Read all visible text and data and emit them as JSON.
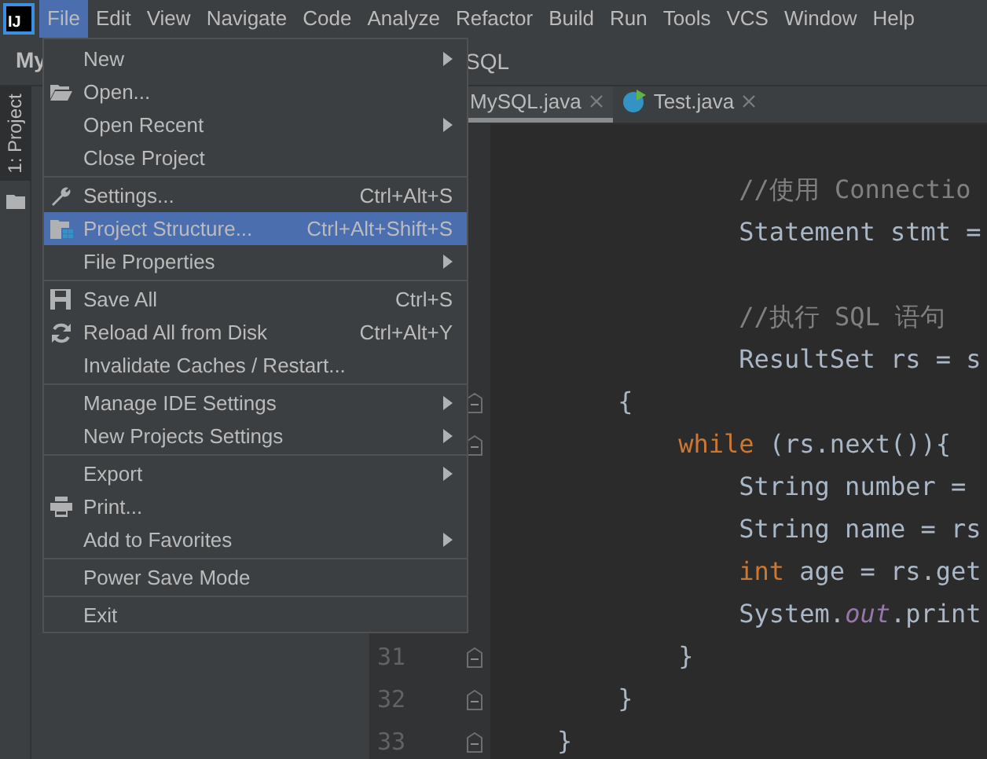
{
  "logo": {
    "text": "IJ"
  },
  "menubar": [
    {
      "label": "File",
      "selected": true
    },
    {
      "label": "Edit",
      "selected": false
    },
    {
      "label": "View",
      "selected": false
    },
    {
      "label": "Navigate",
      "selected": false
    },
    {
      "label": "Code",
      "selected": false
    },
    {
      "label": "Analyze",
      "selected": false
    },
    {
      "label": "Refactor",
      "selected": false
    },
    {
      "label": "Build",
      "selected": false
    },
    {
      "label": "Run",
      "selected": false
    },
    {
      "label": "Tools",
      "selected": false
    },
    {
      "label": "VCS",
      "selected": false
    },
    {
      "label": "Window",
      "selected": false
    },
    {
      "label": "Help",
      "selected": false
    }
  ],
  "navbar": {
    "project": "My",
    "file": "SQL"
  },
  "tool_window_tab": {
    "label": "1: Project",
    "selected": true
  },
  "editor_tabs": [
    {
      "label": "MySQL.java",
      "selected": true,
      "kind": "plain"
    },
    {
      "label": "Test.java",
      "selected": false,
      "kind": "class"
    }
  ],
  "code_blocks": [
    [
      {
        "tokens": [
          {
            "kind": "comment",
            "text": "                //使用 Connectio"
          }
        ]
      },
      {
        "tokens": [
          {
            "kind": "plain",
            "text": "                Statement stmt ="
          }
        ]
      }
    ],
    [
      {
        "tokens": [
          {
            "kind": "comment",
            "text": "                //执行 SQL 语句"
          }
        ]
      },
      {
        "tokens": [
          {
            "kind": "plain",
            "text": "                ResultSet rs = s"
          }
        ]
      },
      {
        "tokens": [
          {
            "kind": "plain",
            "text": "        {"
          }
        ],
        "fold": true
      },
      {
        "tokens": [
          {
            "kind": "keyword",
            "text": "            while"
          },
          {
            "kind": "plain",
            "text": " (rs.next()){"
          }
        ],
        "fold": true
      },
      {
        "tokens": [
          {
            "kind": "plain",
            "text": "                String number ="
          }
        ]
      },
      {
        "tokens": [
          {
            "kind": "plain",
            "text": "                String name = rs"
          }
        ]
      },
      {
        "tokens": [
          {
            "kind": "keyword",
            "text": "                int"
          },
          {
            "kind": "plain",
            "text": " age = rs.get"
          }
        ]
      },
      {
        "tokens": [
          {
            "kind": "plain",
            "text": "                System."
          },
          {
            "kind": "field",
            "text": "out"
          },
          {
            "kind": "plain",
            "text": ".print"
          }
        ]
      },
      {
        "number": "31",
        "tokens": [
          {
            "kind": "plain",
            "text": "            }"
          }
        ],
        "fold": true
      },
      {
        "number": "32",
        "tokens": [
          {
            "kind": "plain",
            "text": "        }"
          }
        ],
        "fold": true
      },
      {
        "number": "33",
        "tokens": [
          {
            "kind": "plain",
            "text": "    }"
          }
        ],
        "fold": true
      }
    ]
  ],
  "file_menu": {
    "groups": [
      [
        {
          "label": "New",
          "submenu": true,
          "selected": false
        },
        {
          "label": "Open...",
          "selected": false
        },
        {
          "label": "Open Recent",
          "submenu": true,
          "selected": false
        },
        {
          "label": "Close Project",
          "selected": false
        }
      ],
      [
        {
          "label": "Settings...",
          "shortcut": "Ctrl+Alt+S",
          "selected": false
        },
        {
          "label": "Project Structure...",
          "shortcut": "Ctrl+Alt+Shift+S",
          "selected": true
        },
        {
          "label": "File Properties",
          "submenu": true,
          "selected": false
        }
      ],
      [
        {
          "label": "Save All",
          "shortcut": "Ctrl+S",
          "selected": false
        },
        {
          "label": "Reload All from Disk",
          "shortcut": "Ctrl+Alt+Y",
          "selected": false
        },
        {
          "label": "Invalidate Caches / Restart...",
          "selected": false
        }
      ],
      [
        {
          "label": "Manage IDE Settings",
          "submenu": true,
          "selected": false
        },
        {
          "label": "New Projects Settings",
          "submenu": true,
          "selected": false
        }
      ],
      [
        {
          "label": "Export",
          "submenu": true,
          "selected": false
        },
        {
          "label": "Print...",
          "selected": false
        },
        {
          "label": "Add to Favorites",
          "submenu": true,
          "selected": false
        }
      ],
      [
        {
          "label": "Power Save Mode",
          "selected": false
        }
      ],
      [
        {
          "label": "Exit",
          "selected": false
        }
      ]
    ]
  }
}
